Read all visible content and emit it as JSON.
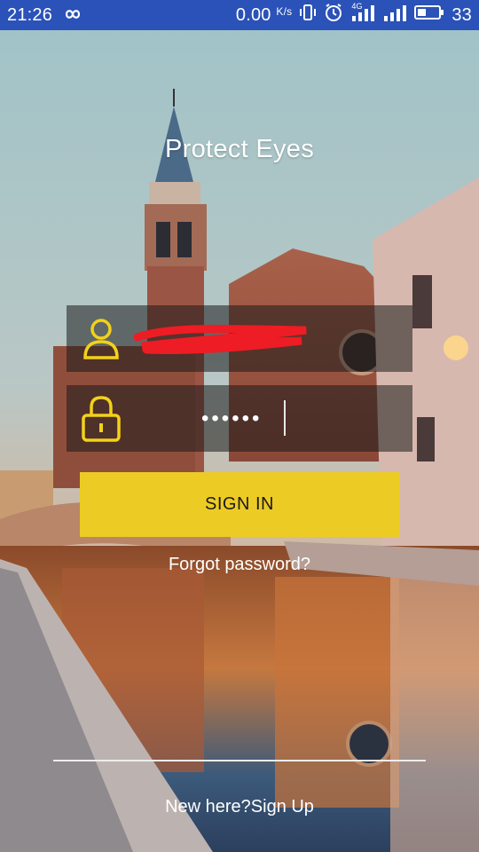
{
  "status_bar": {
    "time": "21:26",
    "net_speed": "0.00",
    "net_unit": "K/s",
    "network_type": "4G",
    "battery": "33",
    "icons": [
      "infinity-icon",
      "vibrate-icon",
      "alarm-icon",
      "signal-icon",
      "signal-icon",
      "battery-icon"
    ]
  },
  "app": {
    "title": "Protect Eyes"
  },
  "login": {
    "username_value": "",
    "password_masked": "••••••",
    "sign_in_label": "SIGN IN",
    "forgot_label": "Forgot password?",
    "signup_label": "New here?Sign Up"
  },
  "colors": {
    "status_bar": "#2a52b8",
    "accent_yellow": "#edcb25",
    "icon_yellow": "#f2d21a",
    "field_bg": "rgba(25,25,25,0.55)"
  }
}
